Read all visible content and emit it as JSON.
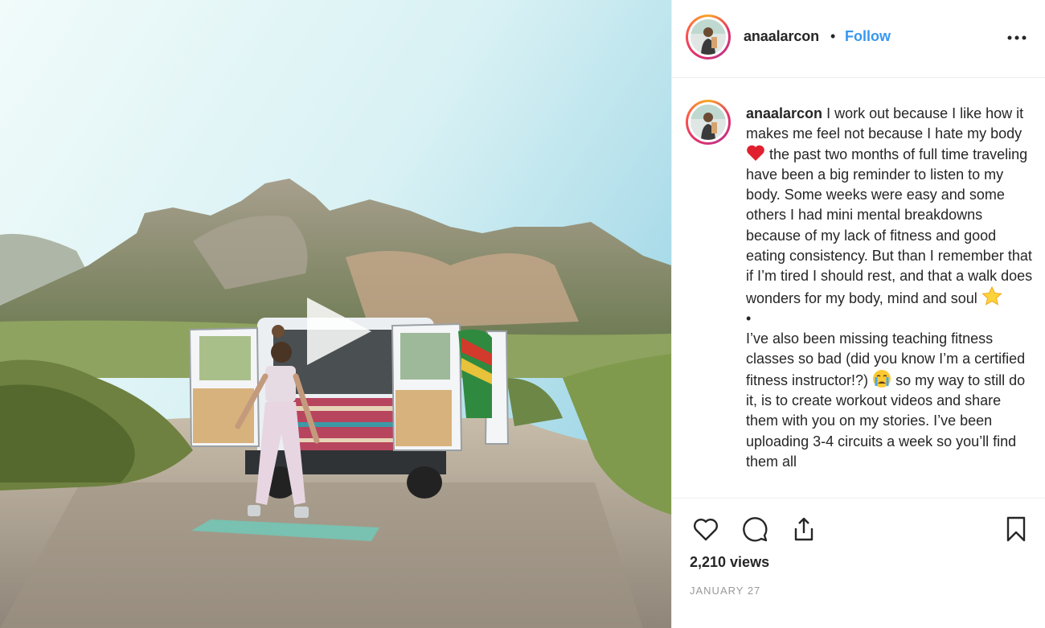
{
  "post": {
    "username": "anaalarcon",
    "separator": "•",
    "follow_label": "Follow",
    "more_icon": "more-options-icon"
  },
  "caption": {
    "username": "anaalarcon",
    "text_1": "I work out because I like how it makes me feel not because I hate my body",
    "emoji_1": "red-heart-emoji",
    "text_2": "the past two months of full time traveling have been a big reminder to listen to my body. Some weeks were easy and some others I had mini mental breakdowns because of my lack of fitness and good eating consistency. But than I remember that if I’m tired I should rest, and that a walk does wonders for my body, mind and soul",
    "emoji_2": "star-emoji",
    "bullet": "•",
    "text_3": "I’ve also been missing teaching fitness classes so bad (did you know I’m a certified fitness instructor!?)",
    "emoji_3": "crying-face-emoji",
    "text_4": "so my way to still do it, is to create workout videos and share them with you on my stories. I’ve been uploading 3-4 circuits a week so you’ll find them all"
  },
  "actions": {
    "like_icon": "heart-icon",
    "comment_icon": "comment-icon",
    "share_icon": "share-icon",
    "save_icon": "bookmark-icon"
  },
  "stats": {
    "views": "2,210 views",
    "date": "JANUARY 27"
  },
  "media": {
    "type": "video",
    "play_icon": "play-icon"
  },
  "colors": {
    "link_blue": "#3897f0",
    "text_dark": "#262626",
    "text_muted": "#999999",
    "divider": "#efefef"
  }
}
